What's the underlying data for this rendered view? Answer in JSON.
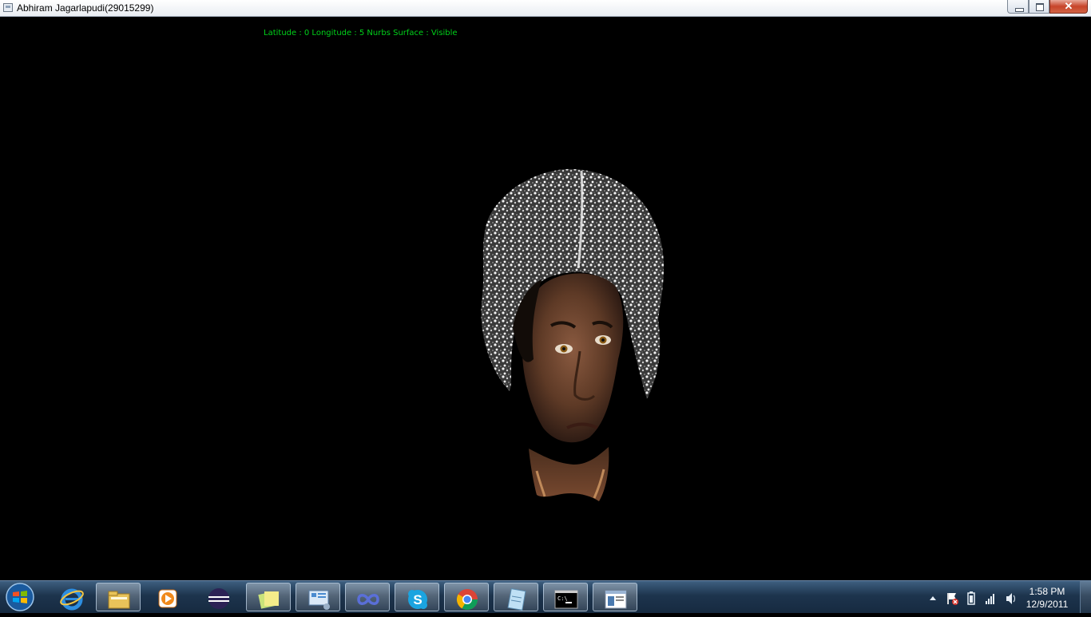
{
  "window": {
    "title": "Abhiram Jagarlapudi(29015299)",
    "minimize_glyph": "",
    "maximize_glyph": "",
    "close_glyph": "✕"
  },
  "viewport": {
    "status_text": "Latitude : 0 Longitude : 5 Nurbs Surface : Visible",
    "status_color": "#00d21a",
    "background": "#000000"
  },
  "taskbar": {
    "start_icon": "windows-start-orb-icon",
    "apps": [
      {
        "name": "internet-explorer-icon",
        "state": "pinned"
      },
      {
        "name": "windows-explorer-icon",
        "state": "active"
      },
      {
        "name": "media-player-icon",
        "state": "pinned"
      },
      {
        "name": "eclipse-icon",
        "state": "pinned"
      },
      {
        "name": "sticky-notes-icon",
        "state": "active"
      },
      {
        "name": "control-panel-icon",
        "state": "active"
      },
      {
        "name": "visual-studio-icon",
        "state": "active"
      },
      {
        "name": "skype-icon",
        "state": "active"
      },
      {
        "name": "chrome-icon",
        "state": "active"
      },
      {
        "name": "notepad-icon",
        "state": "active"
      },
      {
        "name": "command-prompt-icon",
        "state": "active"
      },
      {
        "name": "opengl-window-icon",
        "state": "active"
      }
    ],
    "tray_icons": [
      "show-hidden-icons-arrow-icon",
      "action-center-flag-icon",
      "battery-icon",
      "network-signal-icon",
      "volume-icon"
    ],
    "clock": {
      "time": "1:58 PM",
      "date": "12/9/2011"
    }
  }
}
